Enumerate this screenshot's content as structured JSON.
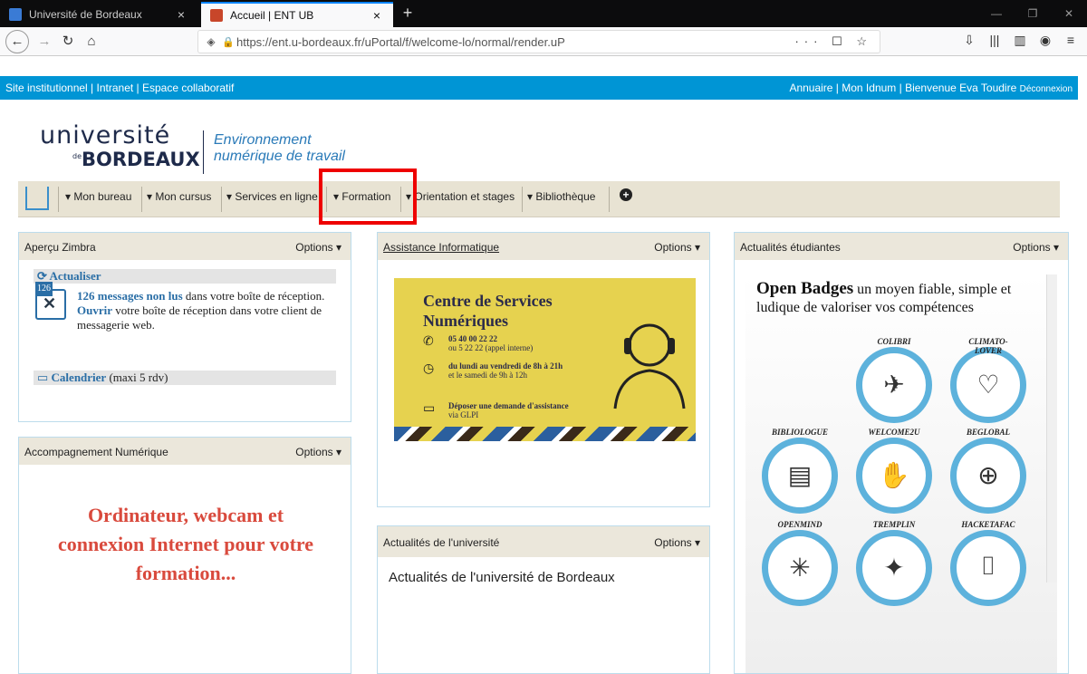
{
  "browser": {
    "tabs": [
      {
        "title": "Université de Bordeaux",
        "close": "×"
      },
      {
        "title": "Accueil | ENT UB",
        "close": "×"
      }
    ],
    "new_tab": "+",
    "url": "https://ent.u-bordeaux.fr/uPortal/f/welcome-lo/normal/render.uP",
    "url_host_bold": "u-bordeaux.fr",
    "url_actions": "··· ☐ ☆"
  },
  "topbar": {
    "left": "Site institutionnel | Intranet | Espace collaboratif",
    "right": "Annuaire | Mon Idnum | Bienvenue Eva Toudire",
    "logout": "Déconnexion"
  },
  "logo": {
    "universite": "université",
    "de": "de",
    "bordeaux": "BORDEAUX",
    "env1": "Environnement",
    "env2": "numérique de travail"
  },
  "nav": {
    "items": [
      "Mon bureau",
      "Mon cursus",
      "Services en ligne",
      "Formation",
      "Orientation et stages",
      "Bibliothèque"
    ],
    "add": "+"
  },
  "portlets": {
    "zimbra": {
      "title": "Aperçu Zimbra",
      "options": "Options",
      "refresh": "Actualiser",
      "count": "126",
      "unread": "126 messages non lus",
      "unread_rest": " dans votre boîte de réception.",
      "open": "Ouvrir",
      "open_rest": " votre boîte de réception dans votre client de messagerie web.",
      "calendar": "Calendrier",
      "calendar_rest": " (maxi 5 rdv)"
    },
    "accompagnement": {
      "title": "Accompagnement Numérique",
      "options": "Options",
      "text": "Ordinateur, webcam et connexion Internet pour votre formation..."
    },
    "assistance": {
      "title": "Assistance Informatique",
      "options": "Options",
      "heading": "Centre de Services Numériques",
      "phone": "05 40 00 22 22",
      "phone2": "ou 5 22 22 (appel interne)",
      "hours": "du lundi au vendredi de 8h à 21h",
      "hours2": "et le samedi de 9h à 12h",
      "request": "Déposer une demande d'assistance",
      "request2": "via GLPI"
    },
    "actu_univ": {
      "title": "Actualités de l'université",
      "options": "Options",
      "text": "Actualités de l'université de Bordeaux"
    },
    "actu_etud": {
      "title": "Actualités étudiantes",
      "options": "Options",
      "headline_bold": "Open Badges",
      "headline_rest": " un moyen fiable, simple et ludique de valoriser vos compétences",
      "badges": [
        "COLIBRI",
        "CLIMATO- LOVER",
        "BIBLIOLOGUE",
        "WELCOME2U",
        "BEGLOBAL",
        "OPENMIND",
        "TREMPLIN",
        "HACKETAFAC"
      ]
    }
  }
}
